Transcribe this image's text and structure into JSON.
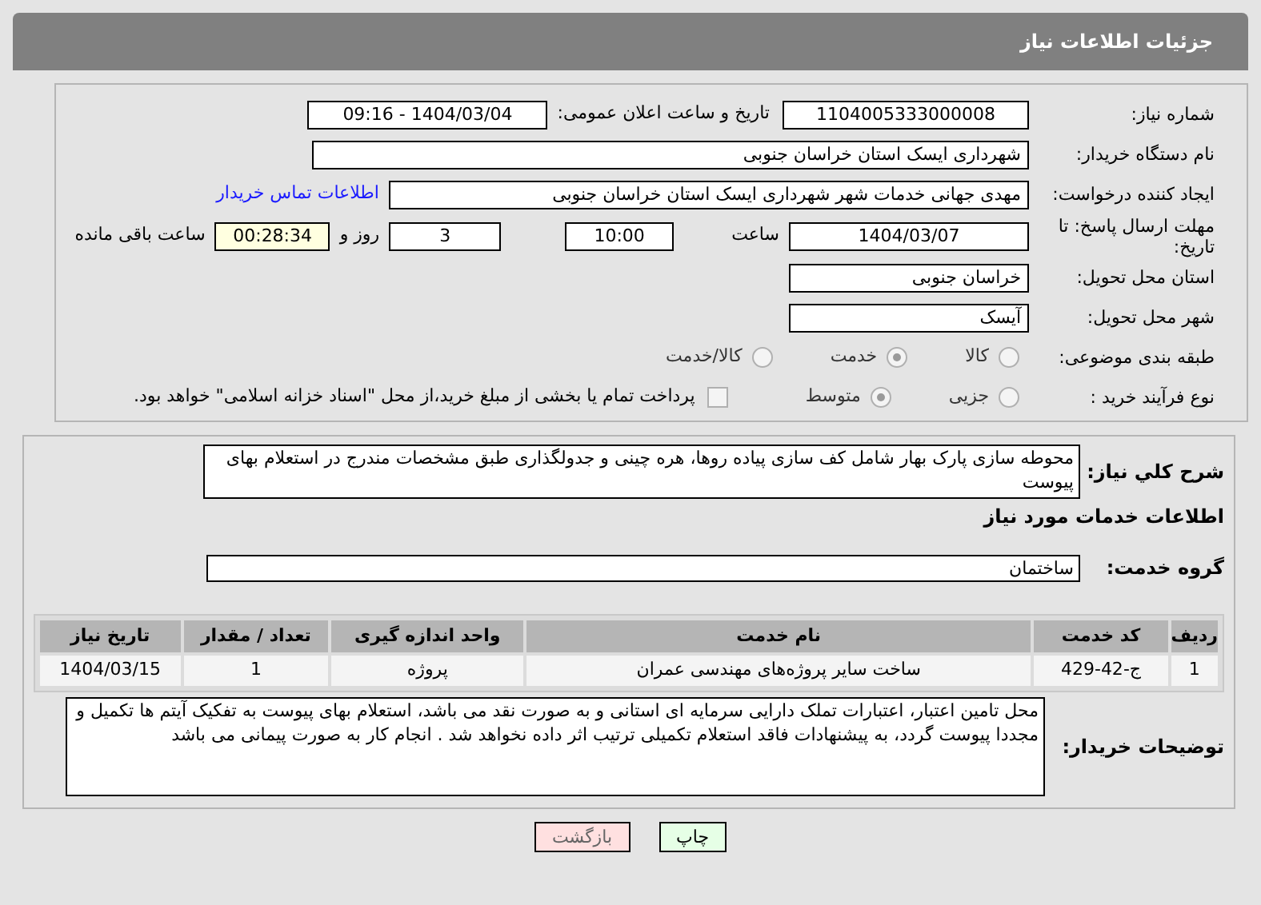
{
  "header": {
    "title": "جزئیات اطلاعات نیاز"
  },
  "fields": [
    {
      "label": "شماره نیاز:",
      "parts": [
        {
          "kind": "field",
          "value": "1104005333000008"
        },
        {
          "kind": "text",
          "value": "تاریخ و ساعت اعلان عمومی:"
        },
        {
          "kind": "field",
          "value": "1404/03/04 - 09:16"
        }
      ]
    },
    {
      "label": "نام دستگاه خریدار:",
      "parts": [
        {
          "kind": "field",
          "value": "شهرداری ایسک استان خراسان جنوبی"
        }
      ]
    },
    {
      "label": "ایجاد کننده درخواست:",
      "parts": [
        {
          "kind": "field",
          "value": "مهدی جهانی خدمات شهر شهرداری ایسک استان خراسان جنوبی"
        },
        {
          "kind": "link",
          "value": "اطلاعات تماس خریدار"
        }
      ]
    },
    {
      "label": "مهلت ارسال پاسخ: تا تاریخ:",
      "parts": [
        {
          "kind": "field",
          "value": "1404/03/07"
        },
        {
          "kind": "text",
          "value": "ساعت"
        },
        {
          "kind": "field",
          "value": "10:00"
        },
        {
          "kind": "field",
          "value": "3"
        },
        {
          "kind": "text",
          "value": "روز و"
        },
        {
          "kind": "field",
          "value": "00:28:34",
          "highlighted": true
        },
        {
          "kind": "text",
          "value": "ساعت باقی مانده"
        }
      ]
    },
    {
      "label": "استان محل تحویل:",
      "parts": [
        {
          "kind": "field",
          "value": "خراسان جنوبی"
        }
      ]
    },
    {
      "label": "شهر محل تحویل:",
      "parts": [
        {
          "kind": "field",
          "value": "آیسک"
        }
      ]
    },
    {
      "label": "طبقه بندی موضوعی:",
      "parts": [
        {
          "kind": "radio",
          "value": "کالا",
          "selected": false
        },
        {
          "kind": "radio",
          "value": "خدمت",
          "selected": true
        },
        {
          "kind": "radio",
          "value": "کالا/خدمت",
          "selected": false
        }
      ]
    },
    {
      "label": "نوع فرآیند خرید :",
      "parts": [
        {
          "kind": "radio",
          "value": "جزیی",
          "selected": false
        },
        {
          "kind": "radio",
          "value": "متوسط",
          "selected": true
        },
        {
          "kind": "checkbox",
          "value": "پرداخت تمام یا بخشی از مبلغ خرید،از محل \"اسناد خزانه اسلامی\" خواهد بود.",
          "checked": false
        }
      ]
    }
  ],
  "description": {
    "label": "شرح کلي نياز:",
    "value": "محوطه سازی پارک بهار شامل کف سازی پیاده روها، هره چینی و جدولگذاری طبق مشخصات مندرج در استعلام بهای پیوست"
  },
  "services_heading": "اطلاعات خدمات مورد نیاز",
  "service_group": {
    "label": "گروه خدمت:",
    "value": "ساختمان"
  },
  "table": {
    "columns": [
      "ردیف",
      "کد خدمت",
      "نام خدمت",
      "واحد اندازه گیری",
      "تعداد / مقدار",
      "تاریخ نیاز"
    ],
    "rows": [
      [
        "1",
        "ج-42-429",
        "ساخت سایر پروژه‌های مهندسی عمران",
        "پروژه",
        "1",
        "1404/03/15"
      ]
    ]
  },
  "buyer_notes": {
    "label": "توضیحات خریدار:",
    "value": "محل تامین اعتبار، اعتبارات تملک دارایی سرمایه ای استانی و به صورت نقد می باشد، استعلام بهای پیوست به تفکیک آیتم ها تکمیل و مجددا پیوست گردد، به پیشنهادات فاقد استعلام تکمیلی ترتیب اثر داده نخواهد شد . انجام کار به صورت پیمانی می باشد"
  },
  "buttons": [
    {
      "kind": "print",
      "label": "چاپ"
    },
    {
      "kind": "back",
      "label": "بازگشت"
    }
  ]
}
